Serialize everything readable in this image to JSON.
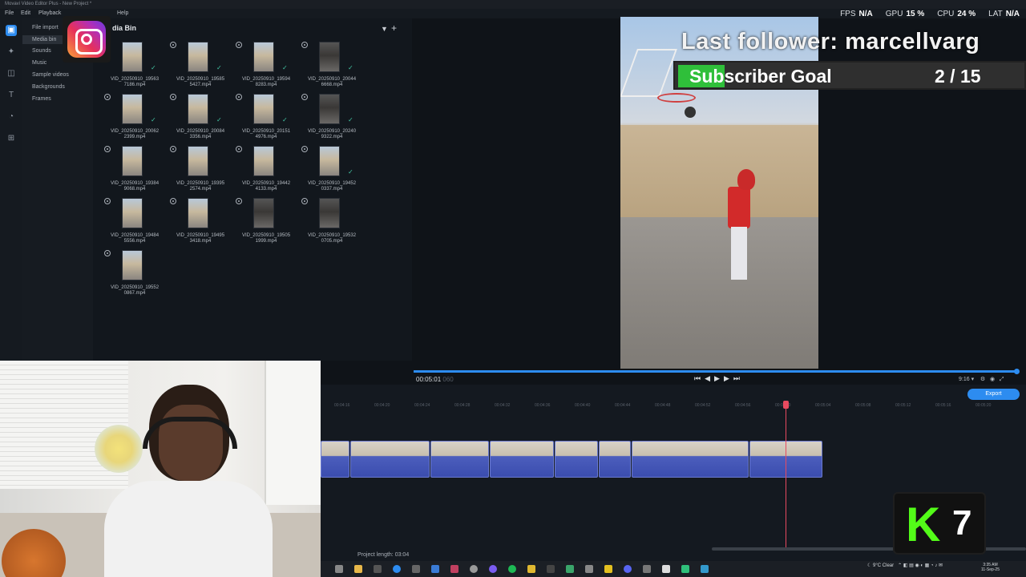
{
  "window": {
    "title": "Movavi Video Editor Plus - New Project *",
    "menu": [
      "File",
      "Edit",
      "Playback",
      "Help"
    ]
  },
  "stats": {
    "fps_label": "FPS",
    "fps_value": "N/A",
    "gpu_label": "GPU",
    "gpu_value": "15 %",
    "cpu_label": "CPU",
    "cpu_value": "24 %",
    "lat_label": "LAT",
    "lat_value": "N/A"
  },
  "sidebar": {
    "rail_icons": [
      "import-icon",
      "magic-icon",
      "transition-icon",
      "text-icon",
      "sticker-icon",
      "grid-icon"
    ],
    "categories": [
      "File import",
      "Media bin",
      "Sounds",
      "Music",
      "Sample videos",
      "Backgrounds",
      "Frames"
    ],
    "active_category": "Media bin"
  },
  "media_bin": {
    "title": "dia Bin",
    "files": [
      {
        "name": "VID_20250910_195637186.mp4",
        "line1": "VID_20250910_19563",
        "line2": "7186.mp4",
        "checked": true
      },
      {
        "name": "VID_20250910_195855427.mp4",
        "line1": "VID_20250910_19585",
        "line2": "5427.mp4",
        "checked": true
      },
      {
        "name": "VID_20250910_195948283.mp4",
        "line1": "VID_20250910_19594",
        "line2": "8283.mp4",
        "checked": true
      },
      {
        "name": "VID_20250910_200446668.mp4",
        "line1": "VID_20250910_20044",
        "line2": "6668.mp4",
        "checked": true
      },
      {
        "name": "VID_20250910_200622399.mp4",
        "line1": "VID_20250910_20062",
        "line2": "2399.mp4",
        "checked": true
      },
      {
        "name": "VID_20250910_200843356.mp4",
        "line1": "VID_20250910_20084",
        "line2": "3356.mp4",
        "checked": true
      },
      {
        "name": "VID_20250910_201514976.mp4",
        "line1": "VID_20250910_20151",
        "line2": "4976.mp4",
        "checked": true
      },
      {
        "name": "VID_20250910_202409322.mp4",
        "line1": "VID_20250910_20240",
        "line2": "9322.mp4",
        "checked": true
      },
      {
        "name": "VID_20250910_193849068.mp4",
        "line1": "VID_20250910_19384",
        "line2": "9068.mp4",
        "checked": false
      },
      {
        "name": "VID_20250910_193952574.mp4",
        "line1": "VID_20250910_19395",
        "line2": "2574.mp4",
        "checked": false
      },
      {
        "name": "VID_20250910_194424133.mp4",
        "line1": "VID_20250910_19442",
        "line2": "4133.mp4",
        "checked": false
      },
      {
        "name": "VID_20250910_194520337.mp4",
        "line1": "VID_20250910_19452",
        "line2": "0337.mp4",
        "checked": true
      },
      {
        "name": "VID_20250910_194845556.mp4",
        "line1": "VID_20250910_19484",
        "line2": "5556.mp4",
        "checked": false
      },
      {
        "name": "VID_20250910_194953418.mp4",
        "line1": "VID_20250910_19495",
        "line2": "3418.mp4",
        "checked": false
      },
      {
        "name": "VID_20250910_195051999.mp4",
        "line1": "VID_20250910_19505",
        "line2": "1999.mp4",
        "checked": false
      },
      {
        "name": "VID_20250910_195320705.mp4",
        "line1": "VID_20250910_19532",
        "line2": "0705.mp4",
        "checked": false
      },
      {
        "name": "VID_20250910_195520867.mp4",
        "line1": "VID_20250910_19552",
        "line2": "0867.mp4",
        "checked": false
      }
    ]
  },
  "overlay": {
    "follower": "Last follower: marcellvarg",
    "goal_label": "Subscriber Goal",
    "goal_count": "2 / 15",
    "goal_progress": 0.1333
  },
  "player": {
    "timecode": "00:05:01",
    "timecode_frames": "060",
    "ratio": "9:16"
  },
  "timeline": {
    "export_label": "Export",
    "ruler": [
      "00:04:16",
      "00:04:20",
      "00:04:24",
      "00:04:28",
      "00:04:32",
      "00:04:36",
      "00:04:40",
      "00:04:44",
      "00:04:48",
      "00:04:52",
      "00:04:56",
      "00:05:00",
      "00:05:04",
      "00:05:08",
      "00:05:12",
      "00:05:16",
      "00:05:20"
    ],
    "project_length": "Project length: 03:04"
  },
  "stream": {
    "kick_letter": "K",
    "kick_number": "7"
  },
  "taskbar": {
    "weather": "9°C Clear",
    "time": "3:35 AM",
    "date": "11-Sep-25"
  }
}
